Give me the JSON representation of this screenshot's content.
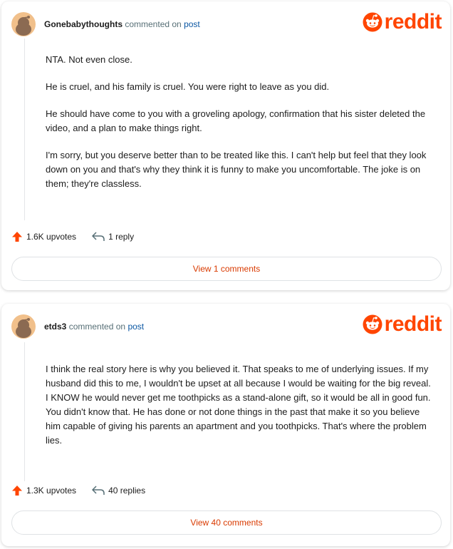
{
  "comments": [
    {
      "username": "Gonebabythoughts",
      "commented_on": "commented on",
      "post_link": "post",
      "brand": "reddit",
      "paragraphs": [
        "NTA. Not even close.",
        "He is cruel, and his family is cruel. You were right to leave as you did.",
        "He should have come to you with a groveling apology, confirmation that his sister deleted the video, and a plan to make things right.",
        "I'm sorry, but you deserve better than to be treated like this. I can't help but feel that they look down on you and that's why they think it is funny to make you uncomfortable. The joke is on them; they're classless."
      ],
      "upvotes": "1.6K upvotes",
      "replies": "1 reply",
      "view_label": "View 1 comments"
    },
    {
      "username": "etds3",
      "commented_on": "commented on",
      "post_link": "post",
      "brand": "reddit",
      "paragraphs": [
        "I think the real story here is why you believed it. That speaks to me of underlying issues. If my husband did this to me, I wouldn't be upset at all because I would be waiting for the big reveal. I KNOW he would never get me toothpicks as a stand-alone gift, so it would be all in good fun. You didn't know that. He has done or not done things in the past that make it so you believe him capable of giving his parents an apartment and you toothpicks. That's where the problem lies."
      ],
      "upvotes": "1.3K upvotes",
      "replies": "40 replies",
      "view_label": "View 40 comments"
    }
  ],
  "colors": {
    "brand": "#ff4500",
    "link": "#0b57a3",
    "view_button_text": "#d93a00",
    "meta_text": "#576f76"
  },
  "icons": [
    "avatar-snoo",
    "reddit-snoo-icon",
    "upvote-arrow-icon",
    "reply-arrow-icon"
  ]
}
